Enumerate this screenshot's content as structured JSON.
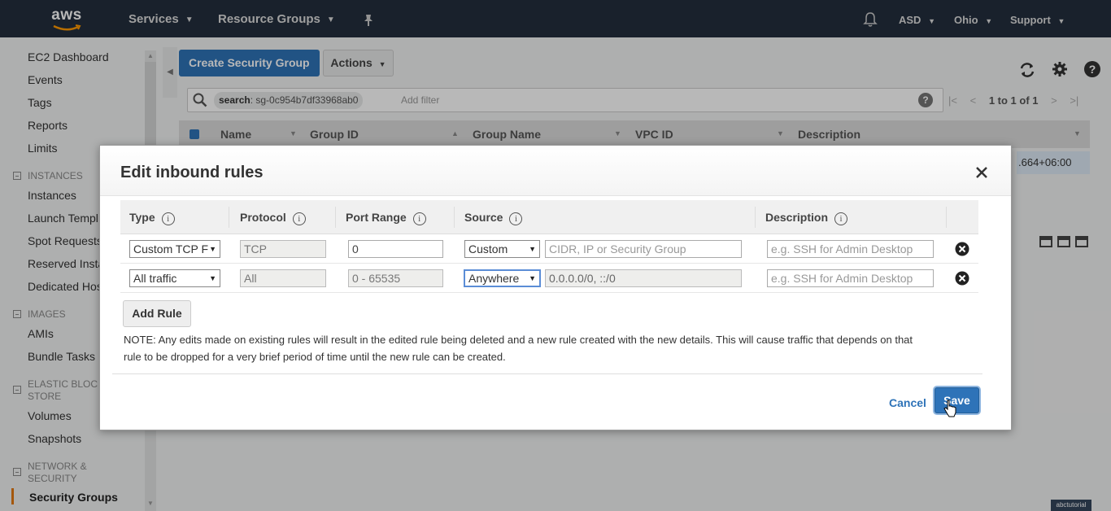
{
  "topnav": {
    "logo": "aws",
    "services": "Services",
    "resource_groups": "Resource Groups",
    "pin_icon": "pin-icon",
    "user": "ASD",
    "region": "Ohio",
    "support": "Support"
  },
  "sidebar": {
    "items": {
      "ec2_dashboard": "EC2 Dashboard",
      "events": "Events",
      "tags": "Tags",
      "reports": "Reports",
      "limits": "Limits",
      "instances": "Instances",
      "launch_templates": "Launch Templ",
      "spot_requests": "Spot Requests",
      "reserved_instances": "Reserved Insta",
      "dedicated_hosts": "Dedicated Hos",
      "amis": "AMIs",
      "bundle_tasks": "Bundle Tasks",
      "volumes": "Volumes",
      "snapshots": "Snapshots",
      "security_groups": "Security Groups"
    },
    "sections": {
      "instances": "INSTANCES",
      "images": "IMAGES",
      "ebs_line1": "ELASTIC BLOC",
      "ebs_line2": "STORE",
      "network_line1": "NETWORK &",
      "network_line2": "SECURITY"
    }
  },
  "toolbar": {
    "create_label": "Create Security Group",
    "actions_label": "Actions"
  },
  "search": {
    "token_key": "search",
    "token_value": ": sg-0c954b7df33968ab0",
    "add_filter": "Add filter",
    "help": "?"
  },
  "pager": {
    "text": "1 to 1 of 1"
  },
  "table": {
    "headers": {
      "name": "Name",
      "group_id": "Group ID",
      "group_name": "Group Name",
      "vpc_id": "VPC ID",
      "description": "Description"
    },
    "row_fragment": ".664+06:00"
  },
  "modal": {
    "title": "Edit inbound rules",
    "headers": {
      "type": "Type",
      "protocol": "Protocol",
      "port_range": "Port Range",
      "source": "Source",
      "description": "Description"
    },
    "info": "i",
    "rules": [
      {
        "type": "Custom TCP F",
        "protocol": "TCP",
        "port_range": "0",
        "source_type": "Custom",
        "source_placeholder": "CIDR, IP or Security Group",
        "description_placeholder": "e.g. SSH for Admin Desktop"
      },
      {
        "type": "All traffic",
        "protocol": "All",
        "port_range": "0 - 65535",
        "source_type": "Anywhere",
        "source_value": "0.0.0.0/0, ::/0",
        "description_placeholder": "e.g. SSH for Admin Desktop"
      }
    ],
    "add_rule": "Add Rule",
    "note_line1": "NOTE: Any edits made on existing rules will result in the edited rule being deleted and a new rule created with the new details. This will cause traffic that depends on that",
    "note_line2": "rule to be dropped for a very brief period of time until the new rule can be created.",
    "cancel": "Cancel",
    "save": "Save"
  },
  "watermark": "abctutorial",
  "colors": {
    "nav_bg": "#232f3e",
    "primary": "#2e73b8",
    "active_bar": "#e47911"
  }
}
